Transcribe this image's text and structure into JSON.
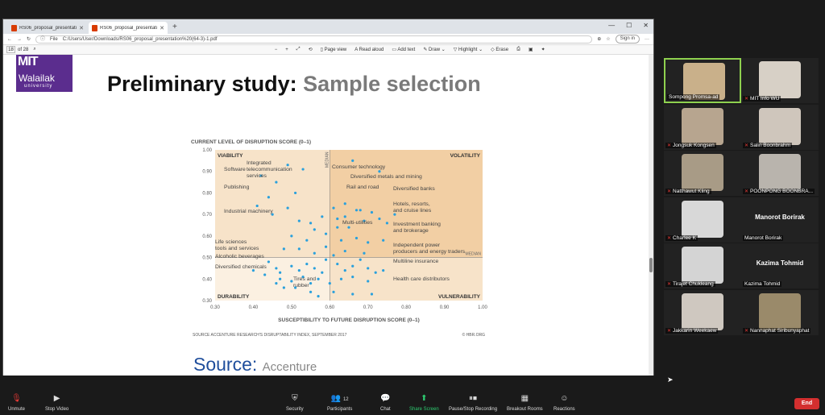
{
  "browser": {
    "tabs": [
      {
        "title": "RS06_proposal_presentation (6-4..."
      },
      {
        "title": "RS06_proposal_presentation (6-4..."
      }
    ],
    "file_label": "File",
    "url": "C:/Users/User/Downloads/RS06_proposal_presentation%20(64-3)-1.pdf",
    "sign_in": "Sign in",
    "page_current": "18",
    "page_total": "of 28",
    "tools": {
      "page_view": "Page view",
      "read_aloud": "Read aloud",
      "add_text": "Add text",
      "draw": "Draw",
      "highlight": "Highlight",
      "erase": "Erase"
    }
  },
  "slide": {
    "logo": {
      "line1": "MIT",
      "line2": "Walailak",
      "line3": "university"
    },
    "title_main": "Preliminary study:",
    "title_sub": "Sample selection",
    "source_big": "Source:",
    "source_big_rest": "Accenture"
  },
  "chart_data": {
    "type": "scatter",
    "title": "CURRENT LEVEL OF DISRUPTION SCORE (0–1)",
    "xlabel": "SUSCEPTIBILITY TO FUTURE DISRUPTION SCORE (0–1)",
    "xlim": [
      0.3,
      1.0
    ],
    "ylim": [
      0.3,
      1.0
    ],
    "x_ticks": [
      "0.30",
      "0.40",
      "0.50",
      "0.60",
      "0.70",
      "0.80",
      "0.90",
      "1.00"
    ],
    "y_ticks": [
      "0.30",
      "0.40",
      "0.50",
      "0.60",
      "0.70",
      "0.80",
      "0.90",
      "1.00"
    ],
    "median_x": 0.6,
    "median_y": 0.5,
    "median_label": "MEDIAN",
    "quadrants": {
      "tl": "VIABILITY",
      "tr": "VOLATILITY",
      "bl": "DURABILITY",
      "br": "VULNERABILITY"
    },
    "colors": {
      "quad_light": "#f7e3c9",
      "quad_dark": "#f2cfa4",
      "point": "#2aa0dc"
    },
    "annotations": [
      "Software",
      "Integrated\ntelecommunication\nservices",
      "Publishing",
      "Industrial machinery",
      "Life sciences\ntools and services",
      "Alcoholic beverages",
      "Diversified chemicals",
      "Tires and\nrubber",
      "Consumer technology",
      "Diversified metals and mining",
      "Rail and road",
      "Diversified banks",
      "Hotels, resorts,\nand cruise lines",
      "Multi-utilities",
      "Investment banking\nand brokerage",
      "Independent power\nproducers and energy traders",
      "Multiline insurance",
      "Health care distributors"
    ],
    "points": [
      [
        0.42,
        0.88
      ],
      [
        0.49,
        0.93
      ],
      [
        0.53,
        0.91
      ],
      [
        0.66,
        0.95
      ],
      [
        0.73,
        0.9
      ],
      [
        0.46,
        0.85
      ],
      [
        0.51,
        0.8
      ],
      [
        0.44,
        0.78
      ],
      [
        0.49,
        0.73
      ],
      [
        0.41,
        0.74
      ],
      [
        0.45,
        0.7
      ],
      [
        0.52,
        0.67
      ],
      [
        0.55,
        0.66
      ],
      [
        0.58,
        0.69
      ],
      [
        0.62,
        0.68
      ],
      [
        0.64,
        0.69
      ],
      [
        0.68,
        0.72
      ],
      [
        0.71,
        0.71
      ],
      [
        0.64,
        0.75
      ],
      [
        0.67,
        0.72
      ],
      [
        0.61,
        0.73
      ],
      [
        0.62,
        0.64
      ],
      [
        0.65,
        0.64
      ],
      [
        0.69,
        0.67
      ],
      [
        0.73,
        0.68
      ],
      [
        0.75,
        0.66
      ],
      [
        0.77,
        0.7
      ],
      [
        0.56,
        0.63
      ],
      [
        0.59,
        0.61
      ],
      [
        0.54,
        0.58
      ],
      [
        0.5,
        0.6
      ],
      [
        0.48,
        0.54
      ],
      [
        0.52,
        0.54
      ],
      [
        0.56,
        0.52
      ],
      [
        0.59,
        0.55
      ],
      [
        0.63,
        0.58
      ],
      [
        0.67,
        0.59
      ],
      [
        0.7,
        0.57
      ],
      [
        0.74,
        0.58
      ],
      [
        0.64,
        0.53
      ],
      [
        0.69,
        0.52
      ],
      [
        0.44,
        0.48
      ],
      [
        0.46,
        0.45
      ],
      [
        0.47,
        0.43
      ],
      [
        0.5,
        0.46
      ],
      [
        0.52,
        0.44
      ],
      [
        0.54,
        0.47
      ],
      [
        0.56,
        0.45
      ],
      [
        0.58,
        0.43
      ],
      [
        0.62,
        0.47
      ],
      [
        0.64,
        0.44
      ],
      [
        0.66,
        0.46
      ],
      [
        0.68,
        0.49
      ],
      [
        0.7,
        0.45
      ],
      [
        0.72,
        0.43
      ],
      [
        0.74,
        0.44
      ],
      [
        0.47,
        0.4
      ],
      [
        0.5,
        0.39
      ],
      [
        0.53,
        0.41
      ],
      [
        0.55,
        0.38
      ],
      [
        0.57,
        0.4
      ],
      [
        0.6,
        0.38
      ],
      [
        0.63,
        0.4
      ],
      [
        0.66,
        0.41
      ],
      [
        0.7,
        0.39
      ],
      [
        0.48,
        0.36
      ],
      [
        0.51,
        0.36
      ],
      [
        0.55,
        0.34
      ],
      [
        0.57,
        0.32
      ],
      [
        0.61,
        0.34
      ],
      [
        0.66,
        0.33
      ],
      [
        0.71,
        0.33
      ],
      [
        0.4,
        0.44
      ],
      [
        0.43,
        0.42
      ],
      [
        0.46,
        0.38
      ],
      [
        0.59,
        0.49
      ],
      [
        0.61,
        0.51
      ]
    ],
    "source": "SOURCE  ACCENTURE RESEARCH'S DISRUPTABILITY INDEX, SEPTEMBER 2017",
    "credit": "© HBR.ORG"
  },
  "participants": [
    {
      "name": "Sompong Promsa-ad",
      "muted": false,
      "speaking": true
    },
    {
      "name": "MIT Info WU",
      "muted": true
    },
    {
      "name": "Jongsuk Kongsen",
      "muted": true
    },
    {
      "name": "Salin Boonbrahm",
      "muted": true
    },
    {
      "name": "Natthawut Kling",
      "muted": true
    },
    {
      "name": "POONPONG BOONBRA...",
      "muted": true
    },
    {
      "name": "Charlee K",
      "muted": true
    },
    {
      "name": "Manorot Borirak",
      "muted": false,
      "display": "Manorot Borirak"
    },
    {
      "name": "Tirajet Chukleang",
      "muted": true
    },
    {
      "name": "Kazima Tohmid",
      "muted": false,
      "display": "Kazima Tohmid"
    },
    {
      "name": "Jakkarin Weekaew",
      "muted": true
    },
    {
      "name": "Nannaphat Siribunyaphat",
      "muted": true
    }
  ],
  "toolbar": {
    "unmute": "Unmute",
    "stop_video": "Stop Video",
    "security": "Security",
    "participants": "Participants",
    "participants_count": "12",
    "chat": "Chat",
    "share_screen": "Share Screen",
    "recording": "Pause/Stop Recording",
    "breakout": "Breakout Rooms",
    "reactions": "Reactions",
    "end": "End"
  }
}
